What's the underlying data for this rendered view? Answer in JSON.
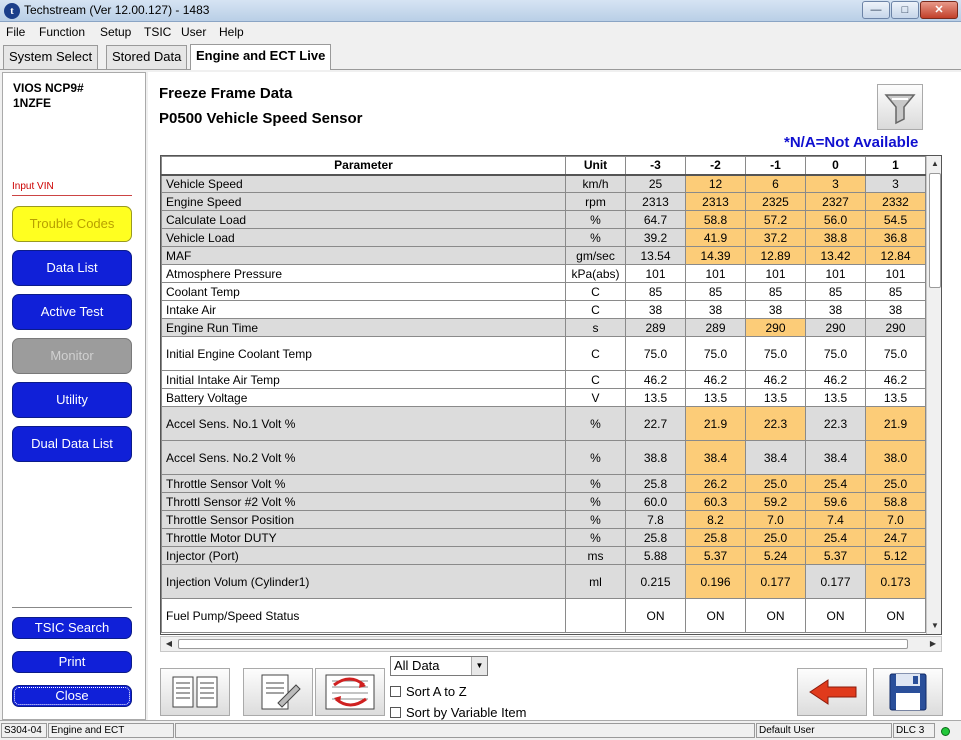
{
  "window": {
    "title": "Techstream (Ver 12.00.127) - 1483"
  },
  "menu": {
    "items": [
      "File",
      "Function",
      "Setup",
      "TSIC",
      "User",
      "Help"
    ]
  },
  "tabs": [
    "System Select",
    "Stored Data",
    "Engine and ECT Live"
  ],
  "left": {
    "vehicle_model": "VIOS NCP9#",
    "engine_code": "1NZFE",
    "input_vin_label": "Input VIN",
    "buttons": [
      "Trouble Codes",
      "Data List",
      "Active Test",
      "Monitor",
      "Utility",
      "Dual Data List"
    ],
    "bottom_buttons": [
      "TSIC Search",
      "Print",
      "Close"
    ]
  },
  "main": {
    "heading": "Freeze Frame Data",
    "dtc": "P0500 Vehicle Speed Sensor",
    "na_note": "*N/A=Not Available"
  },
  "table": {
    "headers": [
      "Parameter",
      "Unit",
      "-3",
      "-2",
      "-1",
      "0",
      "1"
    ],
    "rows": [
      {
        "p": "Vehicle Speed",
        "u": "km/h",
        "v": [
          "25",
          "12",
          "6",
          "3",
          "3"
        ],
        "hl": [
          false,
          true,
          true,
          true,
          false
        ],
        "grey": true,
        "tall": false
      },
      {
        "p": "Engine Speed",
        "u": "rpm",
        "v": [
          "2313",
          "2313",
          "2325",
          "2327",
          "2332"
        ],
        "hl": [
          false,
          true,
          true,
          true,
          true
        ],
        "grey": true,
        "tall": false
      },
      {
        "p": "Calculate Load",
        "u": "%",
        "v": [
          "64.7",
          "58.8",
          "57.2",
          "56.0",
          "54.5"
        ],
        "hl": [
          false,
          true,
          true,
          true,
          true
        ],
        "grey": true,
        "tall": false
      },
      {
        "p": "Vehicle Load",
        "u": "%",
        "v": [
          "39.2",
          "41.9",
          "37.2",
          "38.8",
          "36.8"
        ],
        "hl": [
          false,
          true,
          true,
          true,
          true
        ],
        "grey": true,
        "tall": false
      },
      {
        "p": "MAF",
        "u": "gm/sec",
        "v": [
          "13.54",
          "14.39",
          "12.89",
          "13.42",
          "12.84"
        ],
        "hl": [
          false,
          true,
          true,
          true,
          true
        ],
        "grey": true,
        "tall": false
      },
      {
        "p": "Atmosphere Pressure",
        "u": "kPa(abs)",
        "v": [
          "101",
          "101",
          "101",
          "101",
          "101"
        ],
        "hl": [
          false,
          false,
          false,
          false,
          false
        ],
        "grey": false,
        "tall": false
      },
      {
        "p": "Coolant Temp",
        "u": "C",
        "v": [
          "85",
          "85",
          "85",
          "85",
          "85"
        ],
        "hl": [
          false,
          false,
          false,
          false,
          false
        ],
        "grey": false,
        "tall": false
      },
      {
        "p": "Intake Air",
        "u": "C",
        "v": [
          "38",
          "38",
          "38",
          "38",
          "38"
        ],
        "hl": [
          false,
          false,
          false,
          false,
          false
        ],
        "grey": false,
        "tall": false
      },
      {
        "p": "Engine Run Time",
        "u": "s",
        "v": [
          "289",
          "289",
          "290",
          "290",
          "290"
        ],
        "hl": [
          false,
          false,
          true,
          false,
          false
        ],
        "grey": true,
        "tall": false
      },
      {
        "p": "Initial Engine Coolant Temp",
        "u": "C",
        "v": [
          "75.0",
          "75.0",
          "75.0",
          "75.0",
          "75.0"
        ],
        "hl": [
          false,
          false,
          false,
          false,
          false
        ],
        "grey": false,
        "tall": true
      },
      {
        "p": "Initial Intake Air Temp",
        "u": "C",
        "v": [
          "46.2",
          "46.2",
          "46.2",
          "46.2",
          "46.2"
        ],
        "hl": [
          false,
          false,
          false,
          false,
          false
        ],
        "grey": false,
        "tall": false
      },
      {
        "p": "Battery Voltage",
        "u": "V",
        "v": [
          "13.5",
          "13.5",
          "13.5",
          "13.5",
          "13.5"
        ],
        "hl": [
          false,
          false,
          false,
          false,
          false
        ],
        "grey": false,
        "tall": false
      },
      {
        "p": "Accel Sens. No.1 Volt %",
        "u": "%",
        "v": [
          "22.7",
          "21.9",
          "22.3",
          "22.3",
          "21.9"
        ],
        "hl": [
          false,
          true,
          true,
          false,
          true
        ],
        "grey": true,
        "tall": true
      },
      {
        "p": "Accel Sens. No.2 Volt %",
        "u": "%",
        "v": [
          "38.8",
          "38.4",
          "38.4",
          "38.4",
          "38.0"
        ],
        "hl": [
          false,
          true,
          false,
          false,
          true
        ],
        "grey": true,
        "tall": true
      },
      {
        "p": "Throttle Sensor Volt %",
        "u": "%",
        "v": [
          "25.8",
          "26.2",
          "25.0",
          "25.4",
          "25.0"
        ],
        "hl": [
          false,
          true,
          true,
          true,
          true
        ],
        "grey": true,
        "tall": false
      },
      {
        "p": "Throttl Sensor #2 Volt %",
        "u": "%",
        "v": [
          "60.0",
          "60.3",
          "59.2",
          "59.6",
          "58.8"
        ],
        "hl": [
          false,
          true,
          true,
          true,
          true
        ],
        "grey": true,
        "tall": false
      },
      {
        "p": "Throttle Sensor Position",
        "u": "%",
        "v": [
          "7.8",
          "8.2",
          "7.0",
          "7.4",
          "7.0"
        ],
        "hl": [
          false,
          true,
          true,
          true,
          true
        ],
        "grey": true,
        "tall": false
      },
      {
        "p": "Throttle Motor DUTY",
        "u": "%",
        "v": [
          "25.8",
          "25.8",
          "25.0",
          "25.4",
          "24.7"
        ],
        "hl": [
          false,
          true,
          true,
          true,
          true
        ],
        "grey": true,
        "tall": false
      },
      {
        "p": "Injector (Port)",
        "u": "ms",
        "v": [
          "5.88",
          "5.37",
          "5.24",
          "5.37",
          "5.12"
        ],
        "hl": [
          false,
          true,
          true,
          true,
          true
        ],
        "grey": true,
        "tall": false
      },
      {
        "p": "Injection Volum (Cylinder1)",
        "u": "ml",
        "v": [
          "0.215",
          "0.196",
          "0.177",
          "0.177",
          "0.173"
        ],
        "hl": [
          false,
          true,
          true,
          false,
          true
        ],
        "grey": true,
        "tall": true
      },
      {
        "p": "Fuel Pump/Speed Status",
        "u": "",
        "v": [
          "ON",
          "ON",
          "ON",
          "ON",
          "ON"
        ],
        "hl": [
          false,
          false,
          false,
          false,
          false
        ],
        "grey": false,
        "tall": true
      }
    ]
  },
  "controls": {
    "data_filter": "All Data",
    "sort_az": "Sort A to Z",
    "sort_var": "Sort by Variable Item"
  },
  "status": {
    "code": "S304-04",
    "system": "Engine and ECT",
    "user": "Default User",
    "dlc": "DLC 3"
  },
  "colors": {
    "highlight": "#fccc78",
    "nav_button": "#1020d8",
    "na_note": "#1010d0"
  }
}
